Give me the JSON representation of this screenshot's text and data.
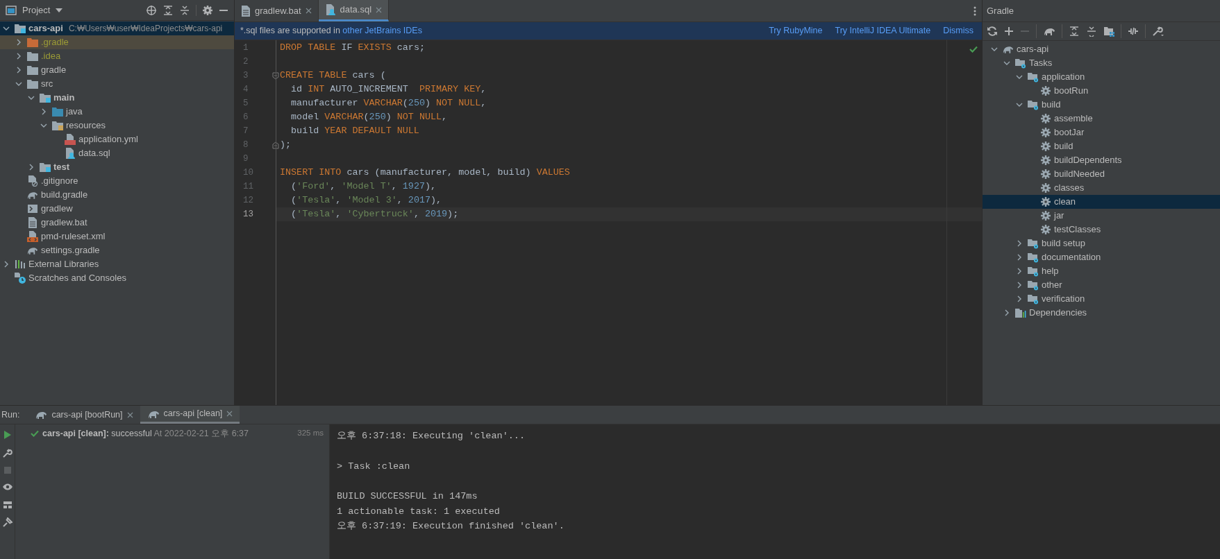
{
  "project_panel": {
    "title": "Project",
    "tree": [
      {
        "label": "cars-api",
        "path": "C:₩Users₩user₩IdeaProjects₩cars-api",
        "kind": "module",
        "bold": true,
        "selected": true,
        "highlighted": false,
        "expanded": true,
        "children": [
          {
            "label": ".gradle",
            "kind": "folder-orange",
            "color": "#9b9b36",
            "bold": false,
            "selected": false,
            "highlighted": true,
            "expanded": false
          },
          {
            "label": ".idea",
            "kind": "folder",
            "color": "#9b9b36",
            "bold": false,
            "selected": false,
            "highlighted": false,
            "expanded": false
          },
          {
            "label": "gradle",
            "kind": "folder",
            "bold": false,
            "selected": false,
            "highlighted": false,
            "expanded": false
          },
          {
            "label": "src",
            "kind": "folder",
            "bold": false,
            "selected": false,
            "highlighted": false,
            "expanded": true,
            "children": [
              {
                "label": "main",
                "kind": "module",
                "bold": true,
                "selected": false,
                "highlighted": false,
                "expanded": true,
                "children": [
                  {
                    "label": "java",
                    "kind": "source",
                    "bold": false,
                    "selected": false,
                    "highlighted": false,
                    "expanded": false
                  },
                  {
                    "label": "resources",
                    "kind": "resources",
                    "bold": false,
                    "selected": false,
                    "highlighted": false,
                    "expanded": true,
                    "children": [
                      {
                        "label": "application.yml",
                        "kind": "yml",
                        "bold": false,
                        "selected": false,
                        "highlighted": false
                      },
                      {
                        "label": "data.sql",
                        "kind": "sql",
                        "bold": false,
                        "selected": false,
                        "highlighted": false
                      }
                    ]
                  }
                ]
              },
              {
                "label": "test",
                "kind": "module",
                "bold": true,
                "selected": false,
                "highlighted": false,
                "expanded": false
              }
            ]
          },
          {
            "label": ".gitignore",
            "kind": "ignore",
            "bold": false,
            "selected": false,
            "highlighted": false
          },
          {
            "label": "build.gradle",
            "kind": "elephant",
            "bold": false,
            "selected": false,
            "highlighted": false
          },
          {
            "label": "gradlew",
            "kind": "script",
            "bold": false,
            "selected": false,
            "highlighted": false
          },
          {
            "label": "gradlew.bat",
            "kind": "text",
            "bold": false,
            "selected": false,
            "highlighted": false
          },
          {
            "label": "pmd-ruleset.xml",
            "kind": "xml",
            "bold": false,
            "selected": false,
            "highlighted": false
          },
          {
            "label": "settings.gradle",
            "kind": "elephant",
            "bold": false,
            "selected": false,
            "highlighted": false
          }
        ]
      },
      {
        "label": "External Libraries",
        "kind": "libraries",
        "bold": false,
        "selected": false,
        "highlighted": false,
        "expanded": false
      },
      {
        "label": "Scratches and Consoles",
        "kind": "scratches",
        "bold": false,
        "selected": false,
        "highlighted": false
      }
    ]
  },
  "editor": {
    "tabs": [
      {
        "label": "gradlew.bat",
        "kind": "text",
        "selected": false
      },
      {
        "label": "data.sql",
        "kind": "sql",
        "selected": true
      }
    ],
    "banner": {
      "text": "*.sql files are supported in ",
      "link": "other JetBrains IDEs",
      "actions": [
        "Try RubyMine",
        "Try IntelliJ IDEA Ultimate",
        "Dismiss"
      ]
    },
    "lines": [
      {
        "number": "1",
        "current": false,
        "tokens": [
          {
            "text": "DROP TABLE",
            "kind": "keyword"
          },
          {
            "text": " IF ",
            "kind": "plain"
          },
          {
            "text": "EXISTS",
            "kind": "keyword"
          },
          {
            "text": " cars;",
            "kind": "plain"
          }
        ]
      },
      {
        "number": "2",
        "current": false
      },
      {
        "number": "3",
        "current": false,
        "kind": "fold-start",
        "tokens": [
          {
            "text": "CREATE TABLE",
            "kind": "keyword"
          },
          {
            "text": " cars (",
            "kind": "plain"
          }
        ]
      },
      {
        "number": "4",
        "current": false,
        "tokens": [
          {
            "text": "  id ",
            "kind": "plain"
          },
          {
            "text": "INT",
            "kind": "keyword"
          },
          {
            "text": " AUTO_INCREMENT  ",
            "kind": "plain"
          },
          {
            "text": "PRIMARY KEY",
            "kind": "keyword"
          },
          {
            "text": ",",
            "kind": "plain"
          }
        ]
      },
      {
        "number": "5",
        "current": false,
        "tokens": [
          {
            "text": "  manufacturer ",
            "kind": "plain"
          },
          {
            "text": "VARCHAR",
            "kind": "keyword"
          },
          {
            "text": "(",
            "kind": "plain"
          },
          {
            "text": "250",
            "kind": "number"
          },
          {
            "text": ") ",
            "kind": "plain"
          },
          {
            "text": "NOT NULL",
            "kind": "keyword"
          },
          {
            "text": ",",
            "kind": "plain"
          }
        ]
      },
      {
        "number": "6",
        "current": false,
        "tokens": [
          {
            "text": "  model ",
            "kind": "plain"
          },
          {
            "text": "VARCHAR",
            "kind": "keyword"
          },
          {
            "text": "(",
            "kind": "plain"
          },
          {
            "text": "250",
            "kind": "number"
          },
          {
            "text": ") ",
            "kind": "plain"
          },
          {
            "text": "NOT NULL",
            "kind": "keyword"
          },
          {
            "text": ",",
            "kind": "plain"
          }
        ]
      },
      {
        "number": "7",
        "current": false,
        "tokens": [
          {
            "text": "  build ",
            "kind": "plain"
          },
          {
            "text": "YEAR DEFAULT NULL",
            "kind": "keyword"
          }
        ]
      },
      {
        "number": "8",
        "current": false,
        "kind": "fold-end",
        "tokens": [
          {
            "text": ");",
            "kind": "plain"
          }
        ]
      },
      {
        "number": "9",
        "current": false
      },
      {
        "number": "10",
        "current": false,
        "tokens": [
          {
            "text": "INSERT INTO",
            "kind": "keyword"
          },
          {
            "text": " cars (manufacturer, model, build) ",
            "kind": "plain"
          },
          {
            "text": "VALUES",
            "kind": "keyword"
          }
        ]
      },
      {
        "number": "11",
        "current": false,
        "tokens": [
          {
            "text": "  (",
            "kind": "plain"
          },
          {
            "text": "'Ford'",
            "kind": "string"
          },
          {
            "text": ", ",
            "kind": "plain"
          },
          {
            "text": "'Model T'",
            "kind": "string"
          },
          {
            "text": ", ",
            "kind": "plain"
          },
          {
            "text": "1927",
            "kind": "number"
          },
          {
            "text": "),",
            "kind": "plain"
          }
        ]
      },
      {
        "number": "12",
        "current": false,
        "tokens": [
          {
            "text": "  (",
            "kind": "plain"
          },
          {
            "text": "'Tesla'",
            "kind": "string"
          },
          {
            "text": ", ",
            "kind": "plain"
          },
          {
            "text": "'Model 3'",
            "kind": "string"
          },
          {
            "text": ", ",
            "kind": "plain"
          },
          {
            "text": "2017",
            "kind": "number"
          },
          {
            "text": "),",
            "kind": "plain"
          }
        ]
      },
      {
        "number": "13",
        "current": true,
        "tokens": [
          {
            "text": "  (",
            "kind": "plain"
          },
          {
            "text": "'Tesla'",
            "kind": "string"
          },
          {
            "text": ", ",
            "kind": "plain"
          },
          {
            "text": "'Cybertruck'",
            "kind": "string"
          },
          {
            "text": ", ",
            "kind": "plain"
          },
          {
            "text": "2019",
            "kind": "number"
          },
          {
            "text": ");",
            "kind": "plain"
          }
        ]
      }
    ]
  },
  "gradle_panel": {
    "title": "Gradle",
    "tree": [
      {
        "label": "cars-api",
        "kind": "elephant",
        "selected": false,
        "expanded": true,
        "children": [
          {
            "label": "Tasks",
            "kind": "task-folder",
            "selected": false,
            "expanded": true,
            "children": [
              {
                "label": "application",
                "kind": "task-folder",
                "selected": false,
                "expanded": true,
                "children": [
                  {
                    "label": "bootRun",
                    "kind": "gear",
                    "selected": false
                  }
                ]
              },
              {
                "label": "build",
                "kind": "task-folder",
                "selected": false,
                "expanded": true,
                "children": [
                  {
                    "label": "assemble",
                    "kind": "gear",
                    "selected": false
                  },
                  {
                    "label": "bootJar",
                    "kind": "gear",
                    "selected": false
                  },
                  {
                    "label": "build",
                    "kind": "gear",
                    "selected": false
                  },
                  {
                    "label": "buildDependents",
                    "kind": "gear",
                    "selected": false
                  },
                  {
                    "label": "buildNeeded",
                    "kind": "gear",
                    "selected": false
                  },
                  {
                    "label": "classes",
                    "kind": "gear",
                    "selected": false
                  },
                  {
                    "label": "clean",
                    "kind": "gear",
                    "selected": true
                  },
                  {
                    "label": "jar",
                    "kind": "gear",
                    "selected": false
                  },
                  {
                    "label": "testClasses",
                    "kind": "gear",
                    "selected": false
                  }
                ]
              },
              {
                "label": "build setup",
                "kind": "task-folder",
                "selected": false,
                "expanded": false
              },
              {
                "label": "documentation",
                "kind": "task-folder",
                "selected": false,
                "expanded": false
              },
              {
                "label": "help",
                "kind": "task-folder",
                "selected": false,
                "expanded": false
              },
              {
                "label": "other",
                "kind": "task-folder",
                "selected": false,
                "expanded": false
              },
              {
                "label": "verification",
                "kind": "task-folder",
                "selected": false,
                "expanded": false
              }
            ]
          },
          {
            "label": "Dependencies",
            "kind": "dependencies",
            "selected": false,
            "expanded": false
          }
        ]
      }
    ]
  },
  "run_panel": {
    "label": "Run:",
    "tabs": [
      {
        "label": "cars-api [bootRun]",
        "selected": false
      },
      {
        "label": "cars-api [clean]",
        "selected": true
      }
    ],
    "result": {
      "name": "cars-api [clean]:",
      "status": " successful",
      "time": "At 2022-02-21 오후 6:37",
      "duration": "325 ms"
    },
    "console": [
      [
        "오후 6:37:18: Executing 'clean'..."
      ],
      [
        "> Task :clean"
      ],
      [
        "BUILD SUCCESSFUL in 147ms",
        "1 actionable task: 1 executed",
        "오후 6:37:19: Execution finished 'clean'."
      ]
    ]
  }
}
